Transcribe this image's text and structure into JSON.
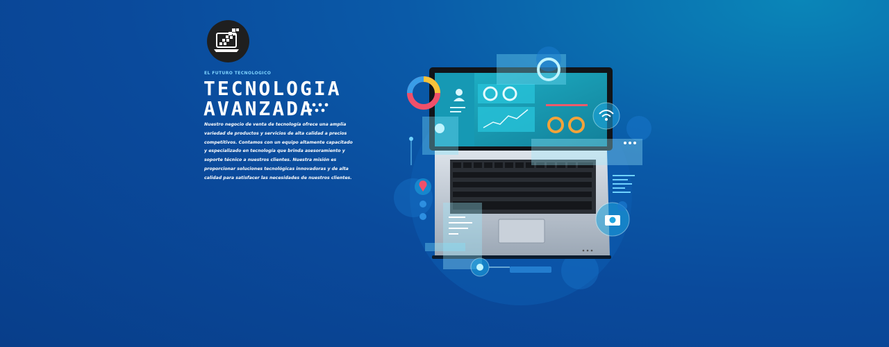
{
  "brand": {
    "logo_icon": "laptop-pixels-icon"
  },
  "hero": {
    "eyebrow": "EL FUTURO TECNOLOGICO",
    "title_line1": "TECNOLOGIA",
    "title_line2": "AVANZADA",
    "description": "Nuestro negocio de venta de tecnología ofrece una amplia variedad de productos y servicios de alta calidad a precios competitivos. Contamos con un equipo altamente capacitado y especializado en tecnología que brinda asesoramiento y soporte técnico a nuestros clientes. Nuestra misión es proporcionar soluciones tecnológicas innovadoras y de alta calidad para satisfacer las necesidades de nuestros clientes."
  },
  "illustration": {
    "subject": "laptop-with-holographic-dashboard",
    "icons": [
      "wifi-icon",
      "camera-icon",
      "location-pin-icon",
      "user-icon",
      "donut-chart-icon",
      "line-chart-icon"
    ]
  },
  "colors": {
    "background_dark": "#083e8a",
    "background_light": "#0a86b8",
    "accent_cyan": "#7fd4ff",
    "text": "#ffffff",
    "badge": "#1f1f1f"
  }
}
